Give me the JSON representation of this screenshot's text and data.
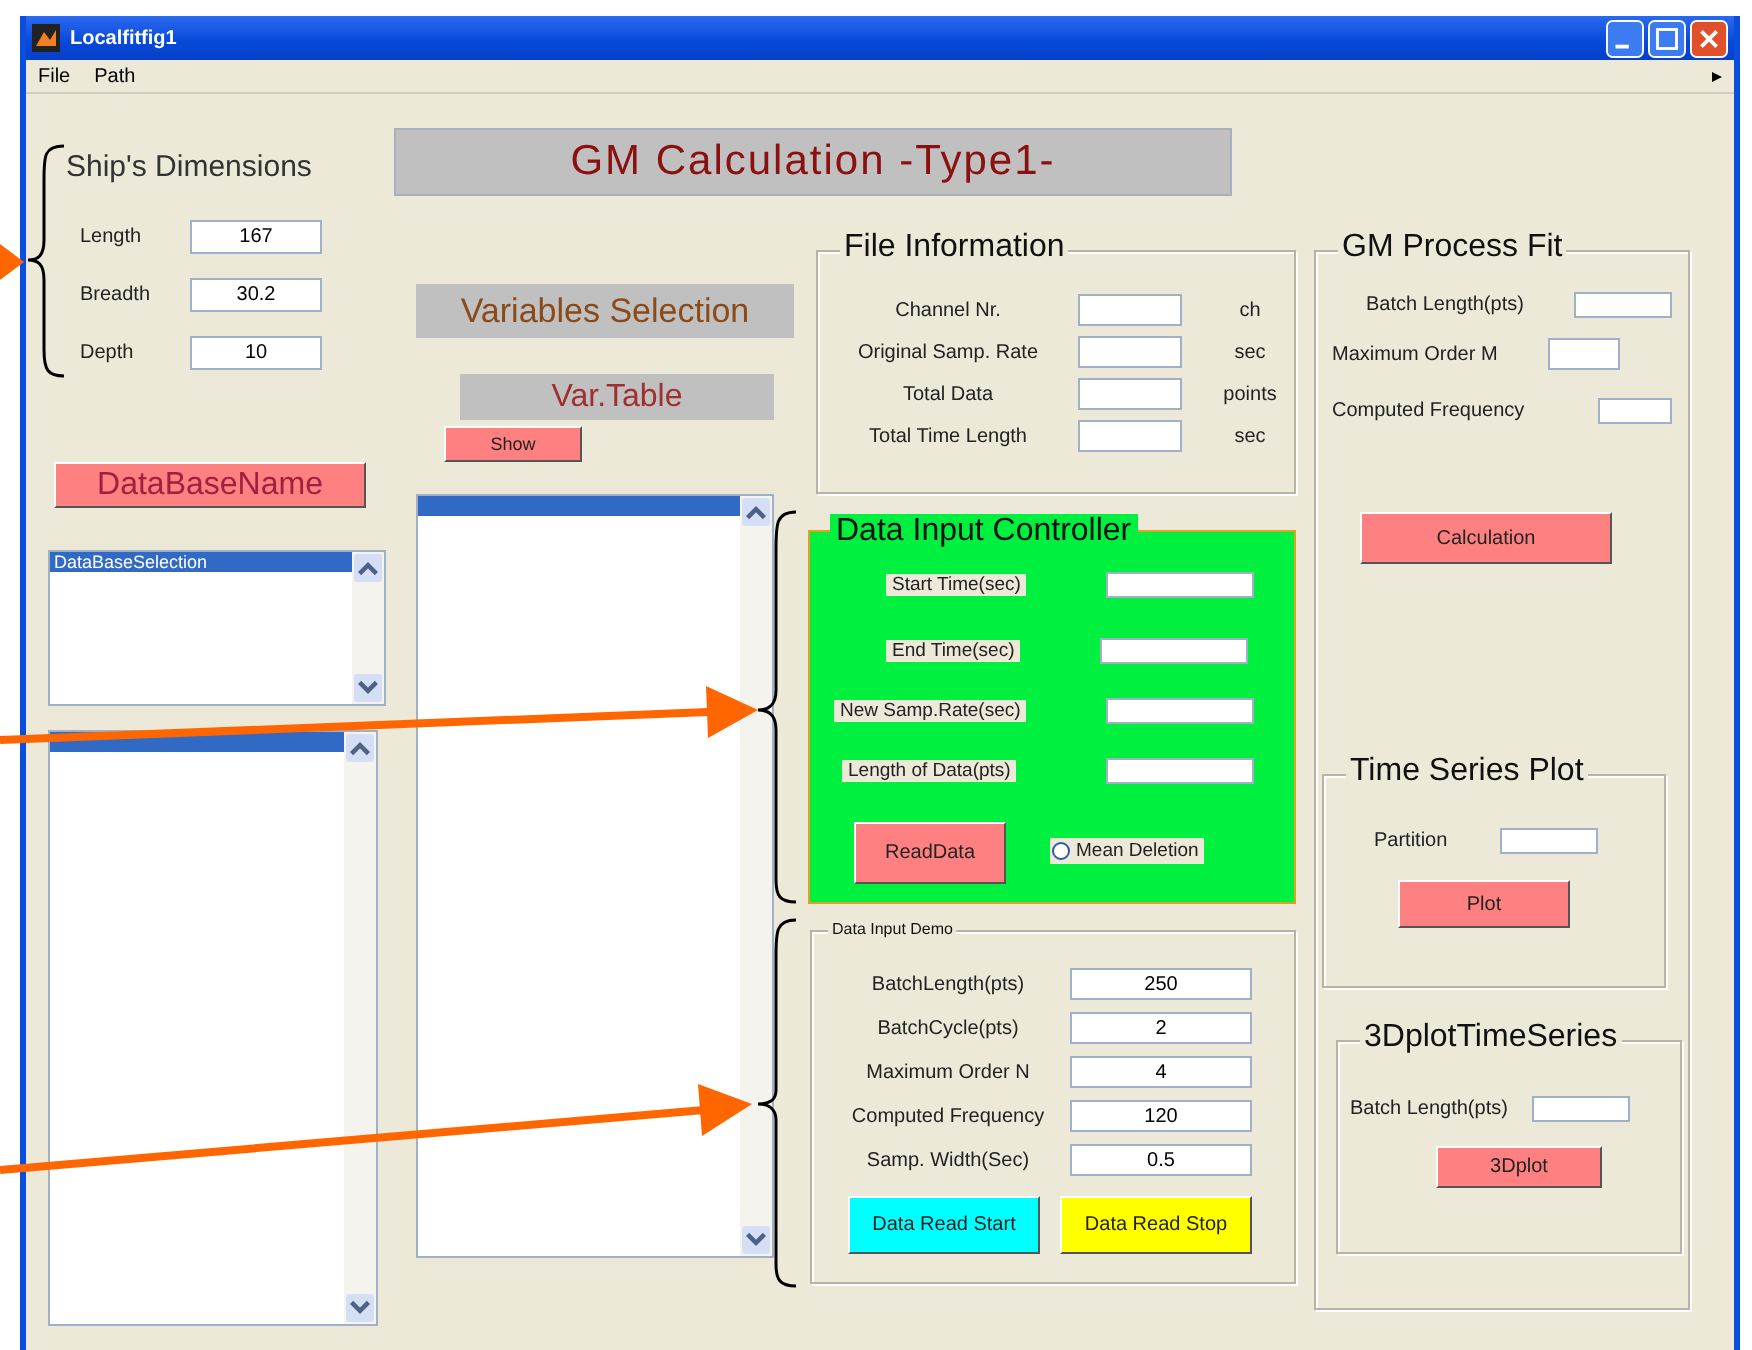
{
  "window": {
    "title": "Localfitfig1"
  },
  "menu": [
    "File",
    "Path"
  ],
  "ships_dimensions": {
    "title": "Ship's Dimensions",
    "fields": [
      {
        "label": "Length",
        "value": "167"
      },
      {
        "label": "Breadth",
        "value": "30.2"
      },
      {
        "label": "Depth",
        "value": "10"
      }
    ]
  },
  "header": "GM Calculation -Type1-",
  "variables_selection": "Variables Selection",
  "var_table": {
    "title": "Var.Table",
    "button": "Show",
    "rows": [
      {
        "selected": true
      }
    ]
  },
  "database": {
    "button": "DataBaseName",
    "list": [
      {
        "text": "DataBaseSelection",
        "selected": true
      }
    ]
  },
  "file_list": [
    {
      "selected": true
    }
  ],
  "file_information": {
    "title": "File Information",
    "rows": [
      {
        "label": "Channel Nr.",
        "unit": "ch"
      },
      {
        "label": "Original Samp. Rate",
        "unit": "sec"
      },
      {
        "label": "Total Data",
        "unit": "points"
      },
      {
        "label": "Total Time Length",
        "unit": "sec"
      }
    ]
  },
  "gm_process_fit": {
    "title": "GM Process Fit",
    "fields": [
      {
        "label": "Batch Length(pts)"
      },
      {
        "label": "Maximum Order M"
      },
      {
        "label": "Computed Frequency"
      }
    ],
    "button": "Calculation"
  },
  "time_series_plot": {
    "title": "Time Series Plot",
    "field_label": "Partition",
    "button": "Plot"
  },
  "plot_3d": {
    "title": "3DplotTimeSeries",
    "field_label": "Batch Length(pts)",
    "button": "3Dplot"
  },
  "data_input_controller": {
    "title": "Data Input Controller",
    "fields": [
      {
        "label": "Start Time(sec)"
      },
      {
        "label": "End Time(sec)"
      },
      {
        "label": "New Samp.Rate(sec)"
      },
      {
        "label": "Length of Data(pts)"
      }
    ],
    "button": "ReadData",
    "radio": {
      "label": "Mean Deletion",
      "checked": false
    }
  },
  "data_input_demo": {
    "title": "Data Input Demo",
    "fields": [
      {
        "label": "BatchLength(pts)",
        "value": "250"
      },
      {
        "label": "BatchCycle(pts)",
        "value": "2"
      },
      {
        "label": "Maximum Order N",
        "value": "4"
      },
      {
        "label": "Computed Frequency",
        "value": "120"
      },
      {
        "label": "Samp. Width(Sec)",
        "value": "0.5"
      }
    ],
    "buttons": [
      {
        "label": "Data Read Start",
        "color": "#00ffff"
      },
      {
        "label": "Data Read Stop",
        "color": "#ffff00"
      }
    ]
  }
}
